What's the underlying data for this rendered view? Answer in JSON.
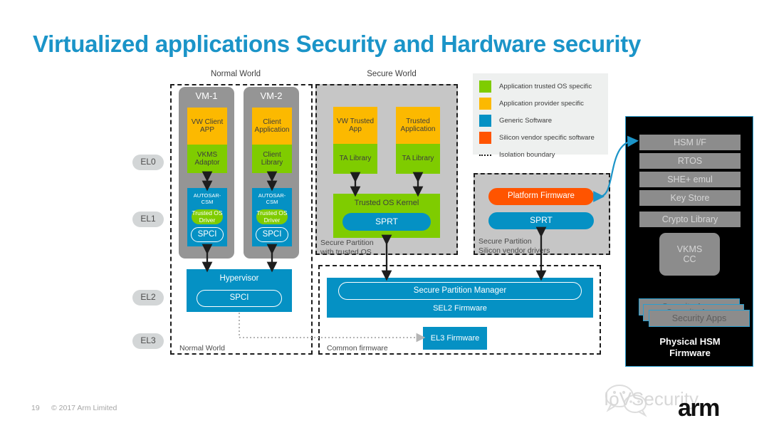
{
  "slide": {
    "title": "Virtualized applications Security and Hardware security",
    "page_number": "19",
    "copyright": "© 2017 Arm Limited",
    "brand": "arm",
    "watermark": "IoVSecurity"
  },
  "colors": {
    "title_blue": "#1b94c8",
    "green": "#7fcc00",
    "amber": "#fcb900",
    "blue": "#0591c4",
    "orange": "#ff5400",
    "grey": "#959595",
    "light_grey": "#c6c6c6",
    "hsm_black": "#000000",
    "hsm_bar": "#8c8c8c"
  },
  "world_headers": {
    "normal": "Normal World",
    "secure": "Secure  World"
  },
  "exception_levels": [
    {
      "label": "EL0"
    },
    {
      "label": "EL1"
    },
    {
      "label": "EL2"
    },
    {
      "label": "EL3"
    }
  ],
  "legend": {
    "items": [
      {
        "color": "#7fcc00",
        "label": "Application trusted OS specific"
      },
      {
        "color": "#fcb900",
        "label": "Application provider specific"
      },
      {
        "color": "#0591c4",
        "label": "Generic Software"
      },
      {
        "color": "#ff5400",
        "label": "Silicon vendor specific software"
      }
    ],
    "boundary_label": "Isolation boundary"
  },
  "normal_world": {
    "footer_label": "Normal World",
    "vms": [
      {
        "title": "VM-1",
        "app": "VW Client\nAPP",
        "library": "VKMS\nAdaptor",
        "csm": "AUTOSAR-\nCSM",
        "driver": "Trusted OS\nDriver",
        "spci": "SPCI"
      },
      {
        "title": "VM-2",
        "app": "Client\nApplication",
        "library": "Client\nLibrary",
        "csm": "AUTOSAR-\nCSM",
        "driver": "Trusted OS\nDriver",
        "spci": "SPCI"
      }
    ],
    "hypervisor": {
      "title": "Hypervisor",
      "spci": "SPCI"
    }
  },
  "secure_world": {
    "trusted_os_partition": {
      "caption": "Secure Partition\nwith trusted OS",
      "apps": [
        {
          "app": "VW Trusted\nApp",
          "library": "TA Library"
        },
        {
          "app": "Trusted\nApplication",
          "library": "TA Library"
        }
      ],
      "kernel": "Trusted OS Kernel",
      "sprt": "SPRT"
    },
    "silicon_partition": {
      "caption": "Secure Partition\nSilicon vendor drivers",
      "platform_firmware": "Platform Firmware",
      "sprt": "SPRT"
    }
  },
  "common_firmware": {
    "footer_label": "Common firmware",
    "spm": "Secure Partition Manager",
    "sel2": "SEL2 Firmware",
    "el3": "EL3 Firmware"
  },
  "hsm": {
    "bars": [
      "HSM I/F",
      "RTOS",
      "SHE+ emul",
      "Key Store",
      "Crypto Library"
    ],
    "vkms": "VKMS\nCC",
    "security_apps": "Security Apps",
    "footer": "Physical HSM\nFirmware"
  }
}
